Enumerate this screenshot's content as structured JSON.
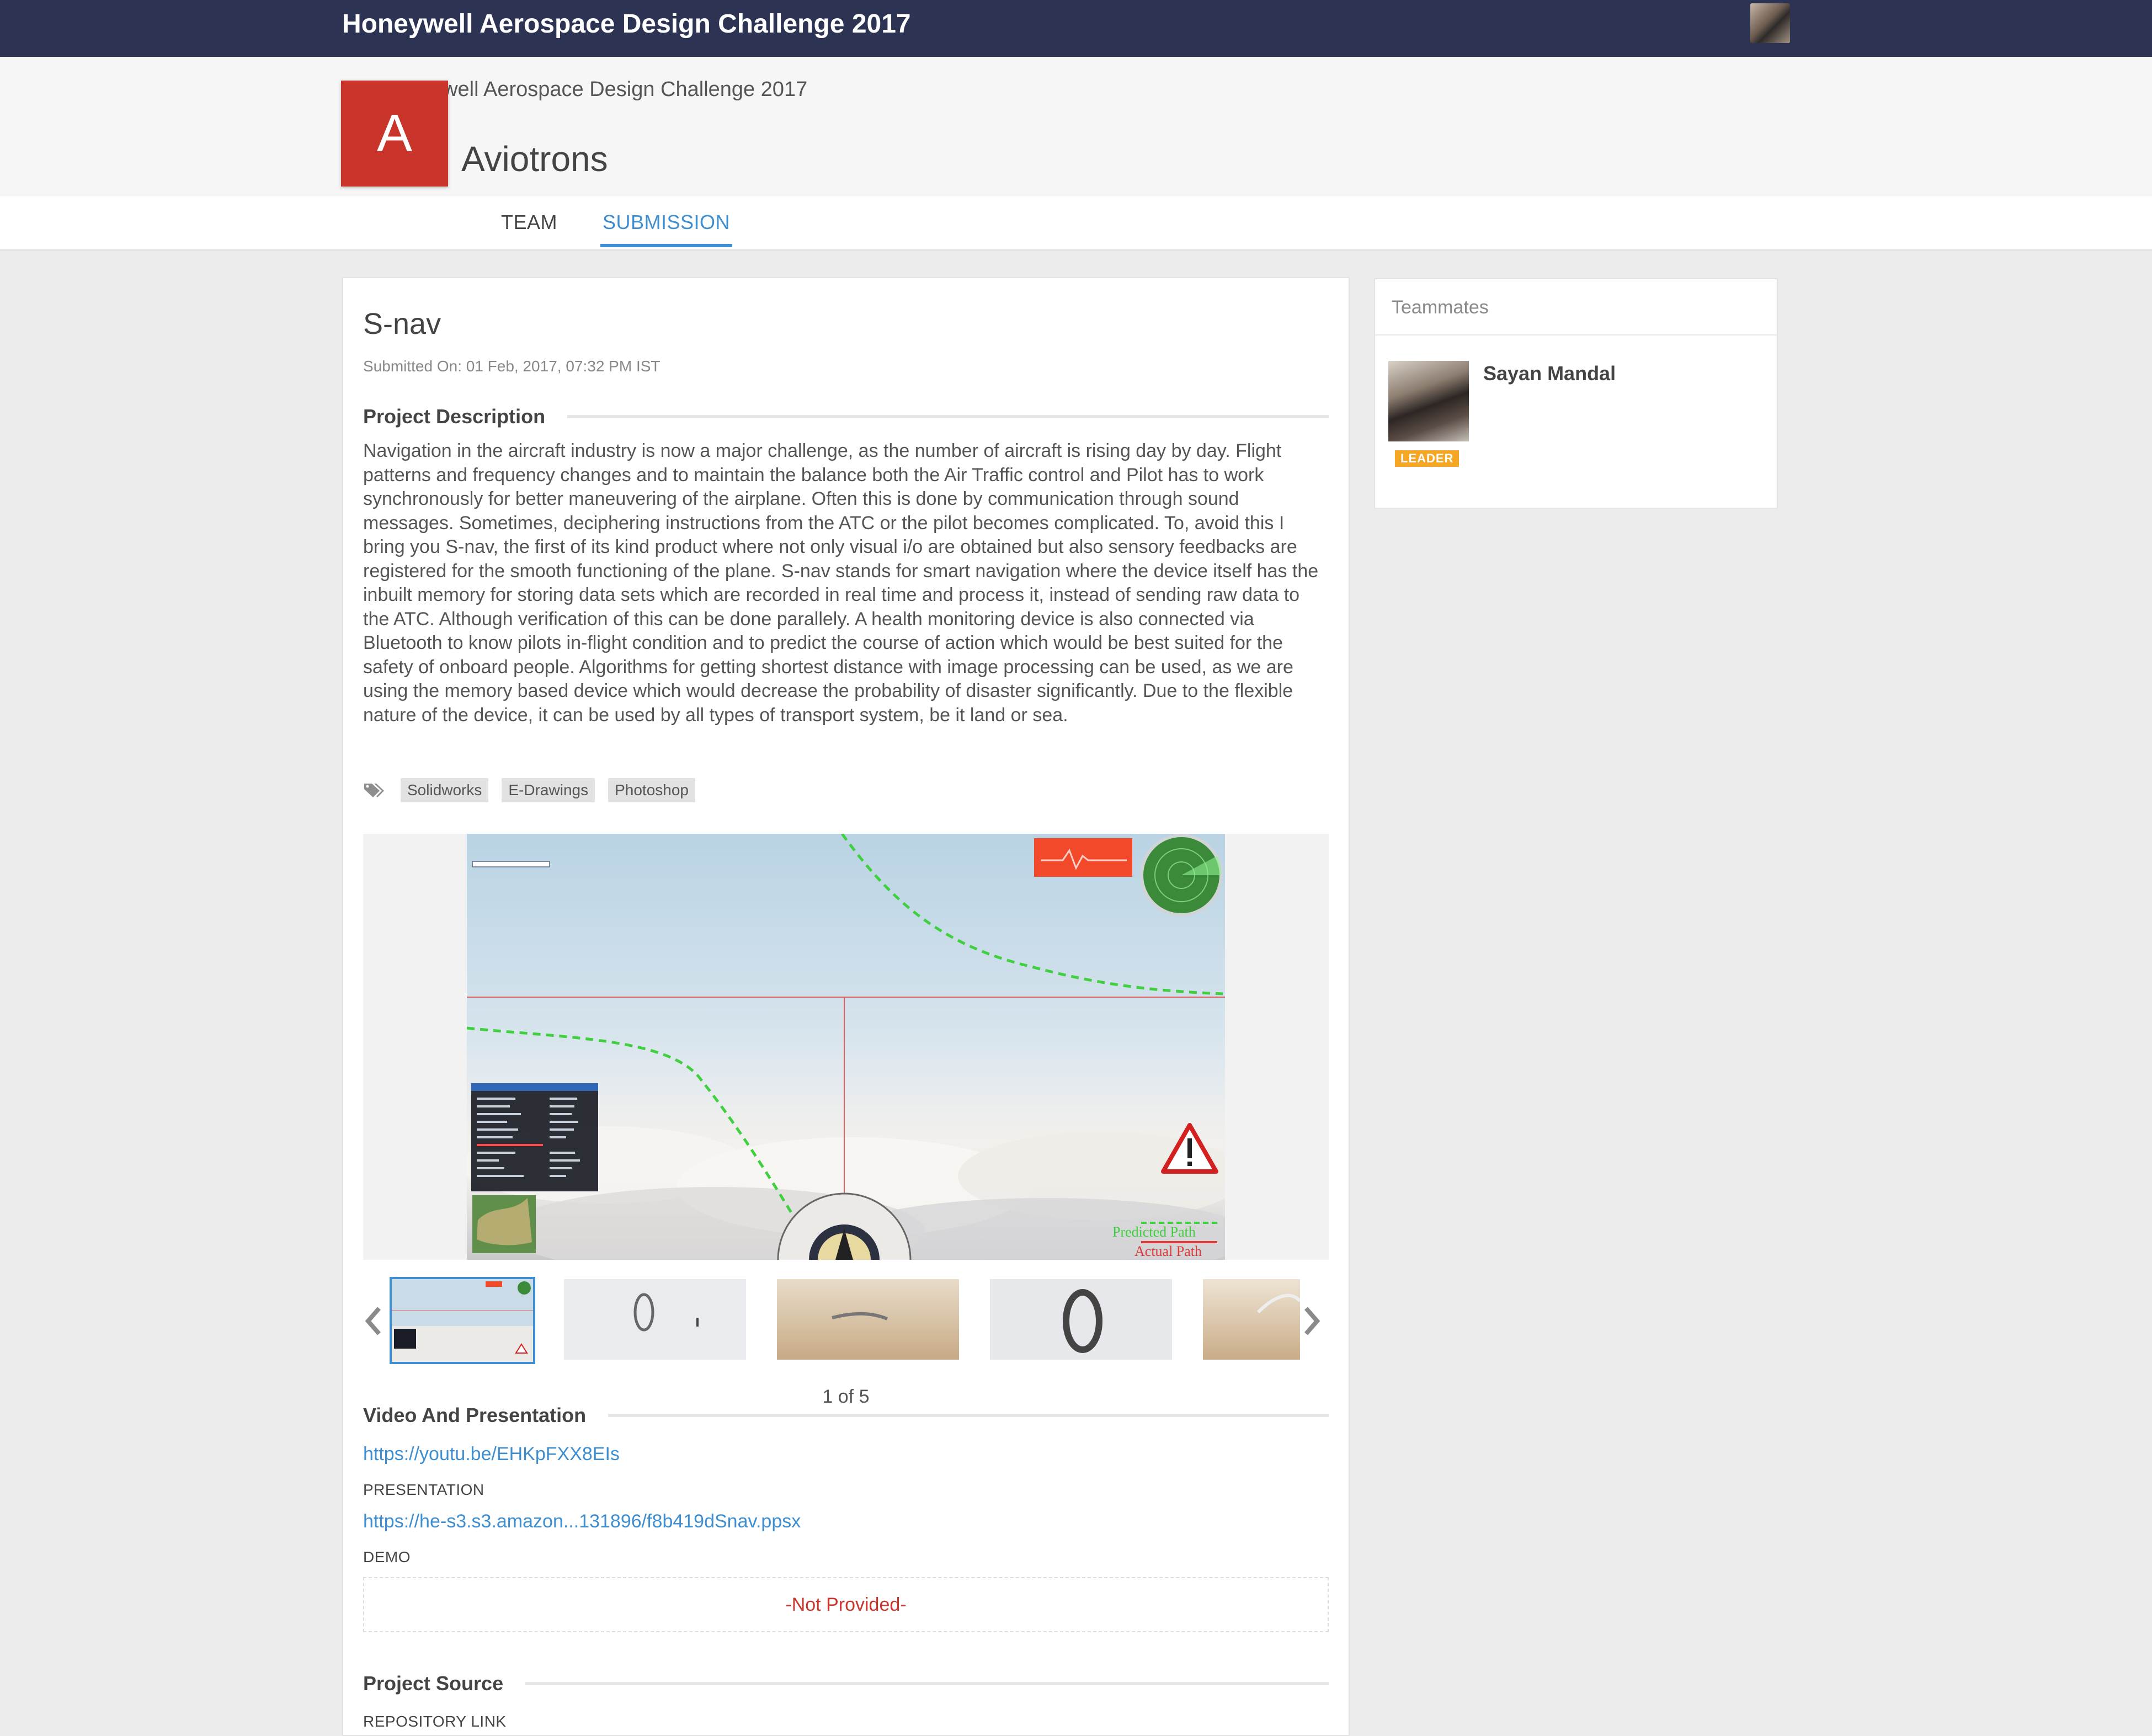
{
  "topbar": {
    "title": "Honeywell Aerospace Design Challenge 2017"
  },
  "header": {
    "back_link": "Honeywell Aerospace Design Challenge 2017",
    "team_initial": "A",
    "team_name": "Aviotrons",
    "tabs": [
      {
        "label": "TEAM",
        "active": false
      },
      {
        "label": "SUBMISSION",
        "active": true
      }
    ]
  },
  "submission": {
    "title": "S-nav",
    "submitted_on": "Submitted On: 01 Feb, 2017, 07:32 PM IST",
    "description_heading": "Project Description",
    "description": "Navigation in the aircraft industry is now a major challenge, as the number of aircraft is rising day by day. Flight patterns and frequency changes and to maintain the balance both the Air Traffic control and Pilot has to work synchronously for better maneuvering of the airplane. Often this is done by communication through sound messages. Sometimes, deciphering instructions from the ATC or the pilot becomes complicated. To, avoid this I bring you S-nav, the first of its kind product where not only visual i/o are obtained but also sensory feedbacks are registered for the smooth functioning of the plane. S-nav stands for smart navigation where the device itself has the inbuilt memory for storing data sets which are recorded in real time and process it, instead of sending raw data to the ATC. Although verification of this can be done parallely. A health monitoring device is also connected via Bluetooth to know pilots in-flight condition and to predict the course of action which would be best suited for the safety of onboard people. Algorithms for getting shortest distance with image processing can be used, as we are using the memory based device which would decrease the probability of disaster significantly. Due to the flexible nature of the device, it can be used by all types of transport system, be it land or sea.",
    "tags": [
      "Solidworks",
      "E-Drawings",
      "Photoshop"
    ],
    "gallery": {
      "counter": "1 of 5",
      "overlay_predicted": "Predicted Path",
      "overlay_actual": "Actual Path"
    },
    "video_heading": "Video And Presentation",
    "video_link": "https://youtu.be/EHKpFXX8EIs",
    "presentation_label": "PRESENTATION",
    "presentation_link": "https://he-s3.s3.amazon...131896/f8b419dSnav.ppsx",
    "demo_label": "DEMO",
    "demo_value": "-Not Provided-",
    "source_heading": "Project Source",
    "repo_label": "REPOSITORY LINK"
  },
  "teammates": {
    "title": "Teammates",
    "members": [
      {
        "name": "Sayan Mandal",
        "badge": "LEADER"
      }
    ]
  },
  "colors": {
    "topbar": "#2c3353",
    "accent": "#3e8ed0",
    "team_logo": "#c9352a",
    "leader_badge": "#f5a623"
  }
}
